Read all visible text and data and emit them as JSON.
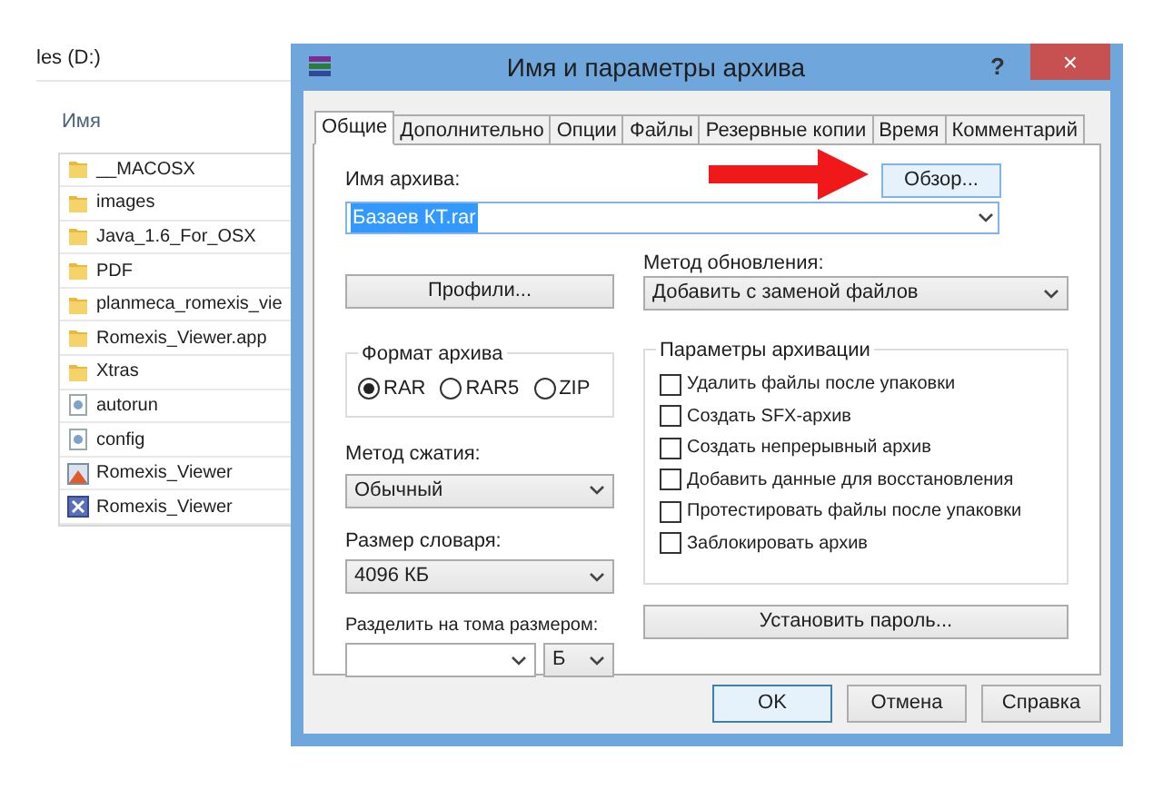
{
  "explorer": {
    "location": "les (D:)",
    "column_header": "Имя",
    "files": [
      {
        "name": "__MACOSX",
        "kind": "folder"
      },
      {
        "name": "images",
        "kind": "folder"
      },
      {
        "name": "Java_1.6_For_OSX",
        "kind": "folder"
      },
      {
        "name": "PDF",
        "kind": "folder"
      },
      {
        "name": "planmeca_romexis_vie",
        "kind": "folder"
      },
      {
        "name": "Romexis_Viewer.app",
        "kind": "folder"
      },
      {
        "name": "Xtras",
        "kind": "folder"
      },
      {
        "name": "autorun",
        "kind": "settings"
      },
      {
        "name": "config",
        "kind": "settings"
      },
      {
        "name": "Romexis_Viewer",
        "kind": "app"
      },
      {
        "name": "Romexis_Viewer",
        "kind": "installer"
      }
    ]
  },
  "dialog": {
    "title": "Имя и параметры архива",
    "help": "?",
    "close": "×",
    "tabs": [
      {
        "label": "Общие",
        "selected": true
      },
      {
        "label": "Дополнительно",
        "selected": false
      },
      {
        "label": "Опции",
        "selected": false
      },
      {
        "label": "Файлы",
        "selected": false
      },
      {
        "label": "Резервные копии",
        "selected": false
      },
      {
        "label": "Время",
        "selected": false
      },
      {
        "label": "Комментарий",
        "selected": false
      }
    ],
    "archive_name": {
      "label": "Имя архива:",
      "value": "Базаев КТ.rar",
      "browse": "Обзор..."
    },
    "profiles": "Профили...",
    "update_method": {
      "label": "Метод обновления:",
      "value": "Добавить с заменой файлов"
    },
    "format": {
      "label": "Формат архива",
      "options": [
        {
          "label": "RAR",
          "selected": true
        },
        {
          "label": "RAR5",
          "selected": false
        },
        {
          "label": "ZIP",
          "selected": false
        }
      ]
    },
    "compression": {
      "label": "Метод сжатия:",
      "value": "Обычный"
    },
    "dictionary": {
      "label": "Размер словаря:",
      "value": "4096 КБ"
    },
    "split": {
      "label": "Разделить на тома размером:",
      "unit": "Б"
    },
    "options": {
      "label": "Параметры архивации",
      "items": [
        {
          "label": "Удалить файлы после упаковки",
          "checked": false
        },
        {
          "label": "Создать SFX-архив",
          "checked": false
        },
        {
          "label": "Создать непрерывный архив",
          "checked": false
        },
        {
          "label": "Добавить данные для восстановления",
          "checked": false
        },
        {
          "label": "Протестировать файлы после упаковки",
          "checked": false
        },
        {
          "label": "Заблокировать архив",
          "checked": false
        }
      ]
    },
    "password": "Установить пароль...",
    "buttons": [
      "OK",
      "Отмена",
      "Справка"
    ]
  }
}
